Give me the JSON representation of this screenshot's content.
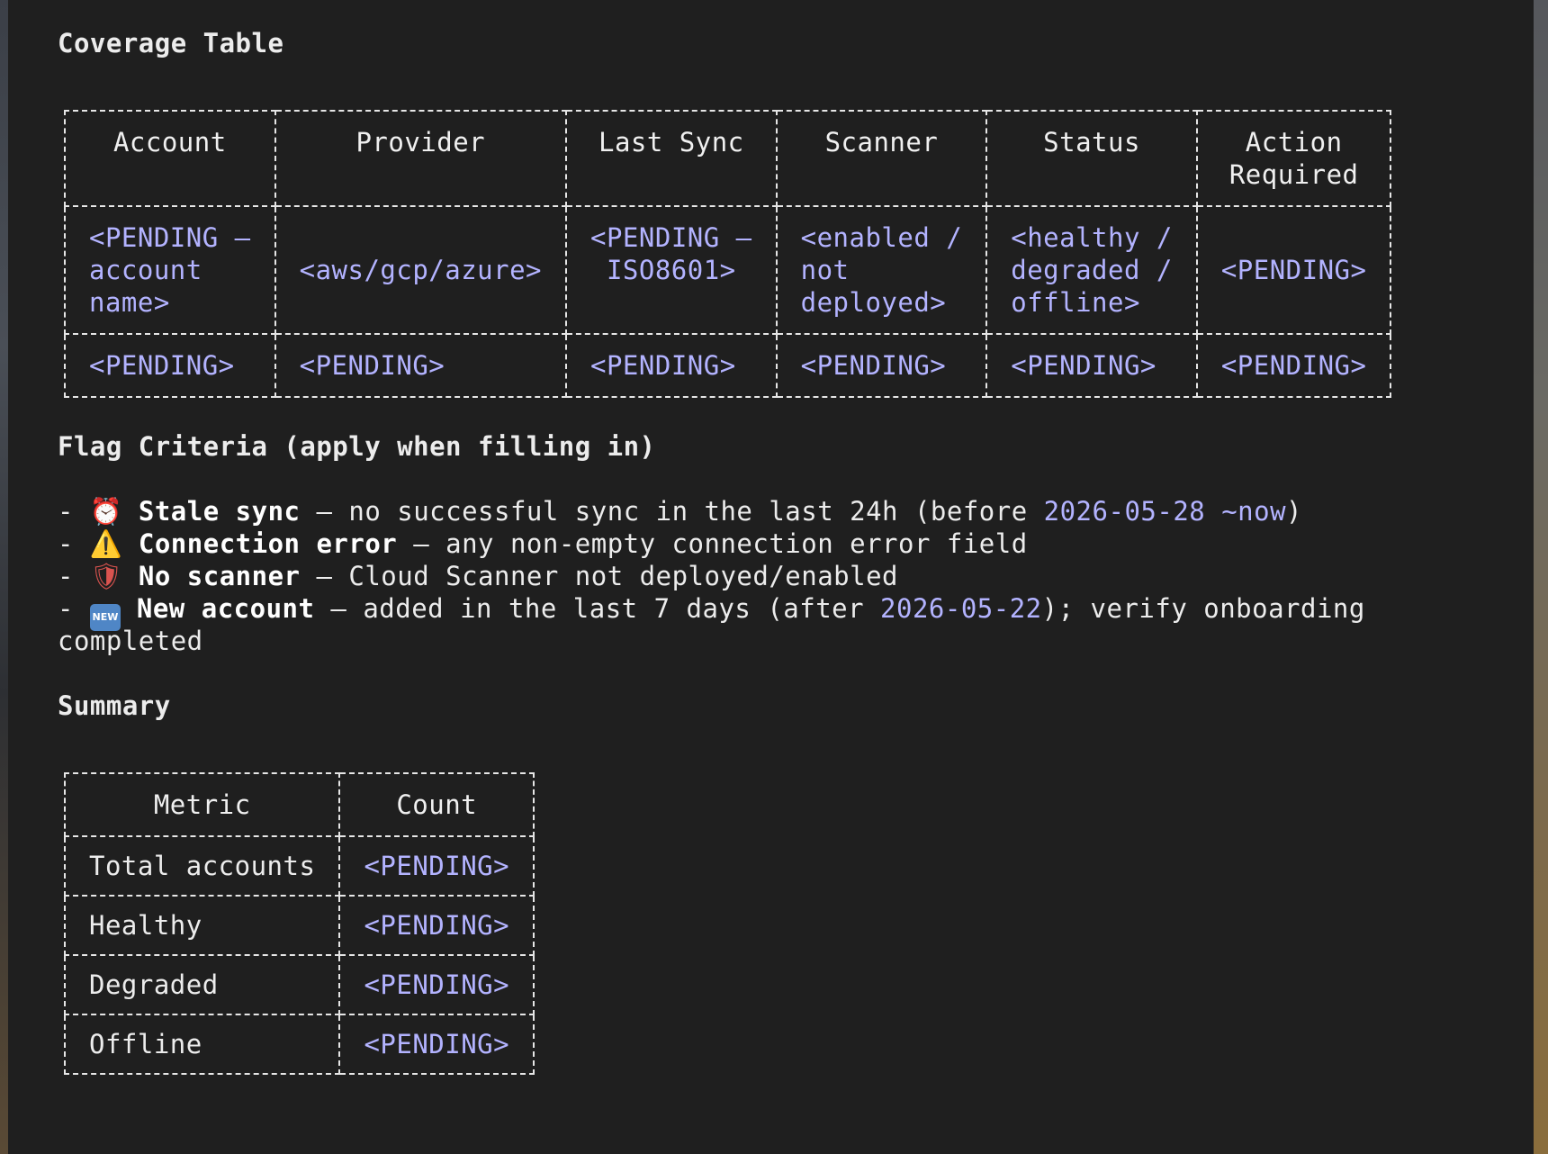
{
  "coverage": {
    "title": "Coverage Table",
    "headers": [
      "Account",
      "Provider",
      "Last Sync",
      "Scanner",
      "Status",
      "Action\nRequired"
    ],
    "rows": [
      [
        "<PENDING —\naccount\nname>",
        "<aws/gcp/azure>",
        "<PENDING —\nISO8601>",
        "<enabled /\nnot\ndeployed>",
        "<healthy /\ndegraded /\noffline>",
        "<PENDING>"
      ],
      [
        "<PENDING>",
        "<PENDING>",
        "<PENDING>",
        "<PENDING>",
        "<PENDING>",
        "<PENDING>"
      ]
    ]
  },
  "flags": {
    "title": "Flag Criteria (apply when filling in)",
    "items": [
      {
        "icon": "alarm-clock-icon",
        "glyph": "⏰",
        "label": "Stale sync",
        "text_before": " — no successful sync in the last 24h (before ",
        "highlight": "2026-05-28 ~now",
        "text_after": ")"
      },
      {
        "icon": "warning-icon",
        "glyph": "⚠️",
        "label": "Connection error",
        "text_before": " — any non-empty connection error field",
        "highlight": "",
        "text_after": ""
      },
      {
        "icon": "shield-icon",
        "glyph": "🛡",
        "label": "No scanner",
        "text_before": " — Cloud Scanner not deployed/enabled",
        "highlight": "",
        "text_after": ""
      },
      {
        "icon": "new-badge-icon",
        "glyph": "NEW",
        "label": "New account",
        "text_before": " — added in the last 7 days (after ",
        "highlight": "2026-05-22",
        "text_after": "); verify onboarding",
        "continuation": "completed"
      }
    ]
  },
  "summary": {
    "title": "Summary",
    "headers": [
      "Metric",
      "Count"
    ],
    "rows": [
      [
        "Total accounts",
        "<PENDING>"
      ],
      [
        "Healthy",
        "<PENDING>"
      ],
      [
        "Degraded",
        "<PENDING>"
      ],
      [
        "Offline",
        "<PENDING>"
      ]
    ]
  },
  "colors": {
    "background": "#1f1f1f",
    "text": "#ececec",
    "placeholder": "#b3b3ff",
    "border": "#e6e6e6"
  }
}
